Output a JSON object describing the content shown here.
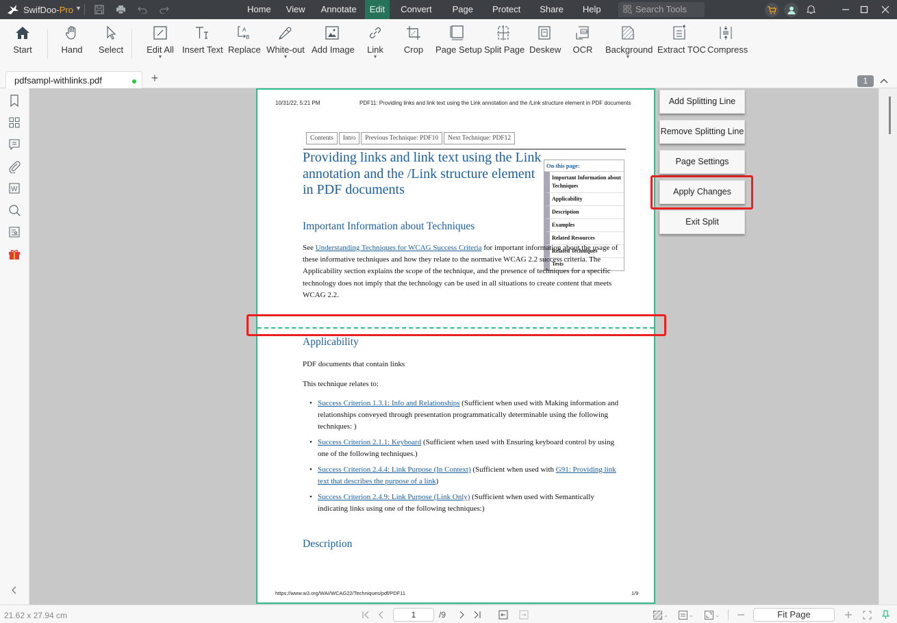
{
  "app": {
    "brand_main": "SwifDoo-",
    "brand_pro": "Pro",
    "menu": [
      "Home",
      "View",
      "Annotate",
      "Edit",
      "Convert",
      "Page",
      "Protect",
      "Share",
      "Help"
    ],
    "active_menu": "Edit",
    "search_placeholder": "Search Tools",
    "colors": {
      "titlebar": "#3c3f43",
      "active_menu": "#26735a",
      "accent_green": "#2bbd8e",
      "highlight_red": "#e82020",
      "cart": "#f5a623"
    }
  },
  "ribbon": {
    "tools": [
      {
        "label": "Start",
        "icon": "home-icon"
      },
      {
        "label": "Hand",
        "icon": "hand-icon"
      },
      {
        "label": "Select",
        "icon": "cursor-icon"
      },
      {
        "label": "Edit All",
        "icon": "edit-all-icon",
        "dropdown": true
      },
      {
        "label": "Insert Text",
        "icon": "insert-text-icon"
      },
      {
        "label": "Replace",
        "icon": "replace-icon"
      },
      {
        "label": "White-out",
        "icon": "whiteout-icon",
        "dropdown": true
      },
      {
        "label": "Add Image",
        "icon": "image-icon"
      },
      {
        "label": "Link",
        "icon": "link-icon",
        "dropdown": true
      },
      {
        "label": "Crop",
        "icon": "crop-icon"
      },
      {
        "label": "Page Setup",
        "icon": "page-setup-icon"
      },
      {
        "label": "Split Page",
        "icon": "split-page-icon"
      },
      {
        "label": "Deskew",
        "icon": "deskew-icon"
      },
      {
        "label": "OCR",
        "icon": "ocr-icon"
      },
      {
        "label": "Background",
        "icon": "background-icon",
        "dropdown": true
      },
      {
        "label": "Extract TOC",
        "icon": "extract-toc-icon"
      },
      {
        "label": "Compress",
        "icon": "compress-icon"
      }
    ]
  },
  "tabs": {
    "doc_name": "pdfsampl-withlinks.pdf",
    "page_badge": "1"
  },
  "sidebar": {
    "items": [
      "bookmark-icon",
      "thumbnails-icon",
      "comments-icon",
      "attachments-icon",
      "word-icon",
      "search-icon",
      "signature-icon",
      "gift-icon"
    ]
  },
  "document": {
    "header_date": "10/31/22, 5:21 PM",
    "header_title": "PDF11: Providing links and link text using the Link annotation and the /Link structure element in PDF documents",
    "nav": [
      "Contents",
      "Intro",
      "Previous Technique: PDF10",
      "Next Technique: PDF12"
    ],
    "title": "Providing links and link text using the Link annotation and the /Link structure element in PDF documents",
    "toc_title": "On this page:",
    "toc": [
      "Important Information about Techniques",
      "Applicability",
      "Description",
      "Examples",
      "Related Resources",
      "Related Techniques",
      "Tests"
    ],
    "section1_heading": "Important Information about Techniques",
    "section1_pre": "See ",
    "section1_link": "Understanding Techniques for WCAG Success Criteria",
    "section1_post": " for important information about the usage of these informative techniques and how they relate to the normative WCAG 2.2 success criteria. The Applicability section explains the scope of the technique, and the presence of techniques for a specific technology does not imply that the technology can be used in all situations to create content that meets WCAG 2.2.",
    "section2_heading": "Applicability",
    "section2_p1": "PDF documents that contain links",
    "section2_p2": "This technique relates to:",
    "criteria": [
      {
        "link": "Success Criterion 1.3.1: Info and Relationships",
        "text": " (Sufficient when used with Making information and relationships conveyed through presentation programmatically determinable using the following techniques: )"
      },
      {
        "link": "Success Criterion 2.1.1: Keyboard",
        "text": " (Sufficient when used with Ensuring keyboard control by using one of the following techniques.)"
      },
      {
        "link": "Success Criterion 2.4.4: Link Purpose (In Context)",
        "text": " (Sufficient when used with ",
        "link2": "G91: Providing link text that describes the purpose of a link",
        "text2": ")"
      },
      {
        "link": "Success Criterion 2.4.9: Link Purpose (Link Only)",
        "text": " (Sufficient when used with Semantically indicating links using one of the following techniques:)"
      }
    ],
    "section3_heading": "Description",
    "footer_url": "https://www.w3.org/WAI/WCAG22/Techniques/pdf/PDF11",
    "footer_page": "1/9"
  },
  "split_panel": {
    "buttons": [
      "Add Splitting Line",
      "Remove Splitting Line",
      "Page Settings",
      "Apply Changes",
      "Exit Split"
    ],
    "highlighted": "Apply Changes"
  },
  "statusbar": {
    "dimensions": "21.62 x 27.94 cm",
    "current_page": "1",
    "total_pages": "/9",
    "zoom_mode": "Fit Page"
  }
}
